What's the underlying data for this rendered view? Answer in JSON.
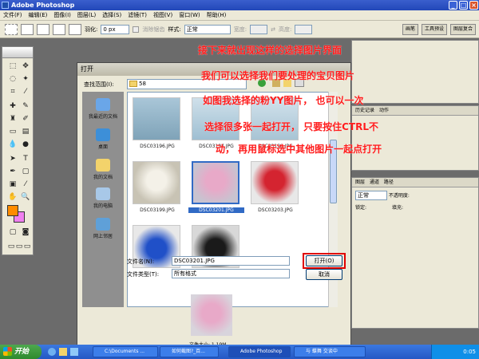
{
  "window": {
    "title": "Adobe Photoshop"
  },
  "menubar": {
    "items": [
      "文件(F)",
      "编辑(E)",
      "图像(I)",
      "图层(L)",
      "选择(S)",
      "滤镜(T)",
      "视图(V)",
      "窗口(W)",
      "帮助(H)"
    ]
  },
  "options": {
    "feather_label": "羽化:",
    "feather_value": "0 px",
    "antialias_label": "消除锯齿",
    "style_label": "样式:",
    "style_value": "正常",
    "width_label": "宽度:",
    "height_label": "高度:",
    "panel_tabs": [
      "画笔",
      "工具预设",
      "图层复合"
    ]
  },
  "right_panels": {
    "history_tabs": [
      "历史记录",
      "动作"
    ],
    "layers_tabs": [
      "图层",
      "通道",
      "路径"
    ],
    "blend_mode": "正常",
    "opacity_label": "不透明度:",
    "lock_label": "锁定:",
    "fill_label": "填充:"
  },
  "dialog": {
    "title": "打开",
    "lookin_label": "查找范围(I):",
    "lookin_value": "58",
    "places": [
      "我最近的文档",
      "桌面",
      "我的文档",
      "我的电脑",
      "网上邻居"
    ],
    "files": [
      "DSC03196.JPG",
      "DSC03197.JPG",
      "DSC03198.JPG",
      "DSC03199.JPG",
      "DSC03201.JPG",
      "DSC03203.JPG"
    ],
    "selected_file": "DSC03201.JPG",
    "filename_label": "文件名(N):",
    "filename_value": "DSC03201.JPG",
    "filetype_label": "文件类型(T):",
    "filetype_value": "所有格式",
    "open_button": "打开(O)",
    "cancel_button": "取消",
    "filesize_text": "文件大小: 1.19M"
  },
  "annotation": {
    "line1": "接下来就出现这样的选择图片界面",
    "line2": "我们可以选择我们要处理的宝贝图片",
    "line3": "如图我选择的粉YY图片， 也可以一次",
    "line4": "选择很多张一起打开， 只要按住CTRL不",
    "line5": "动， 再用鼠标选中其他图片一起点打开"
  },
  "taskbar": {
    "start_label": "开始",
    "tasks": [
      "C:\\Documents ...",
      "如何截图?_百...",
      "Adobe Photoshop",
      "与 蝶舞 交谈中"
    ],
    "clock": "0:05"
  },
  "colors": {
    "annotation_red": "#ff1c1c",
    "highlight_box": "#e00000",
    "selection_blue": "#316ac5",
    "foreground_swatch": "#ff8c00",
    "background_swatch": "#f080f0"
  }
}
